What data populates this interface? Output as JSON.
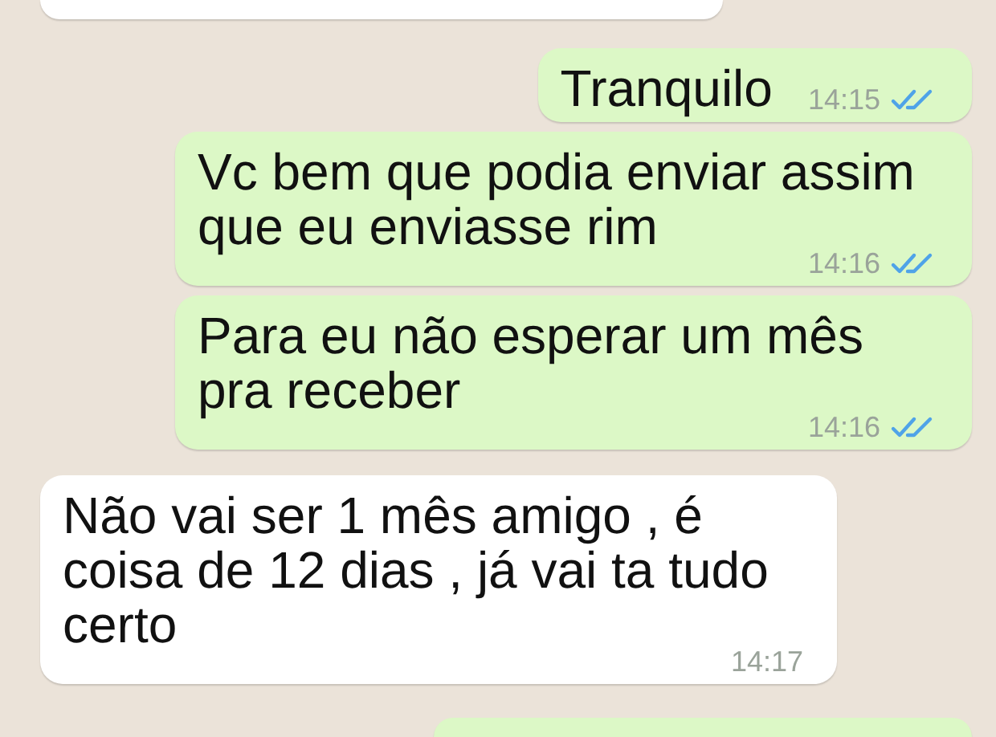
{
  "messages": [
    {
      "kind": "in",
      "partial": true
    },
    {
      "kind": "out",
      "text": "Tranquilo",
      "time": "14:15",
      "read": true
    },
    {
      "kind": "out",
      "text": "Vc bem que podia enviar assim que eu enviasse rim",
      "time": "14:16",
      "read": true
    },
    {
      "kind": "out",
      "text": "Para eu não esperar um mês pra receber",
      "time": "14:16",
      "read": true
    },
    {
      "kind": "in",
      "text": "Não vai ser 1 mês amigo , é coisa de 12 dias , já vai ta tudo certo",
      "time": "14:17"
    },
    {
      "kind": "out",
      "partial": true
    }
  ]
}
